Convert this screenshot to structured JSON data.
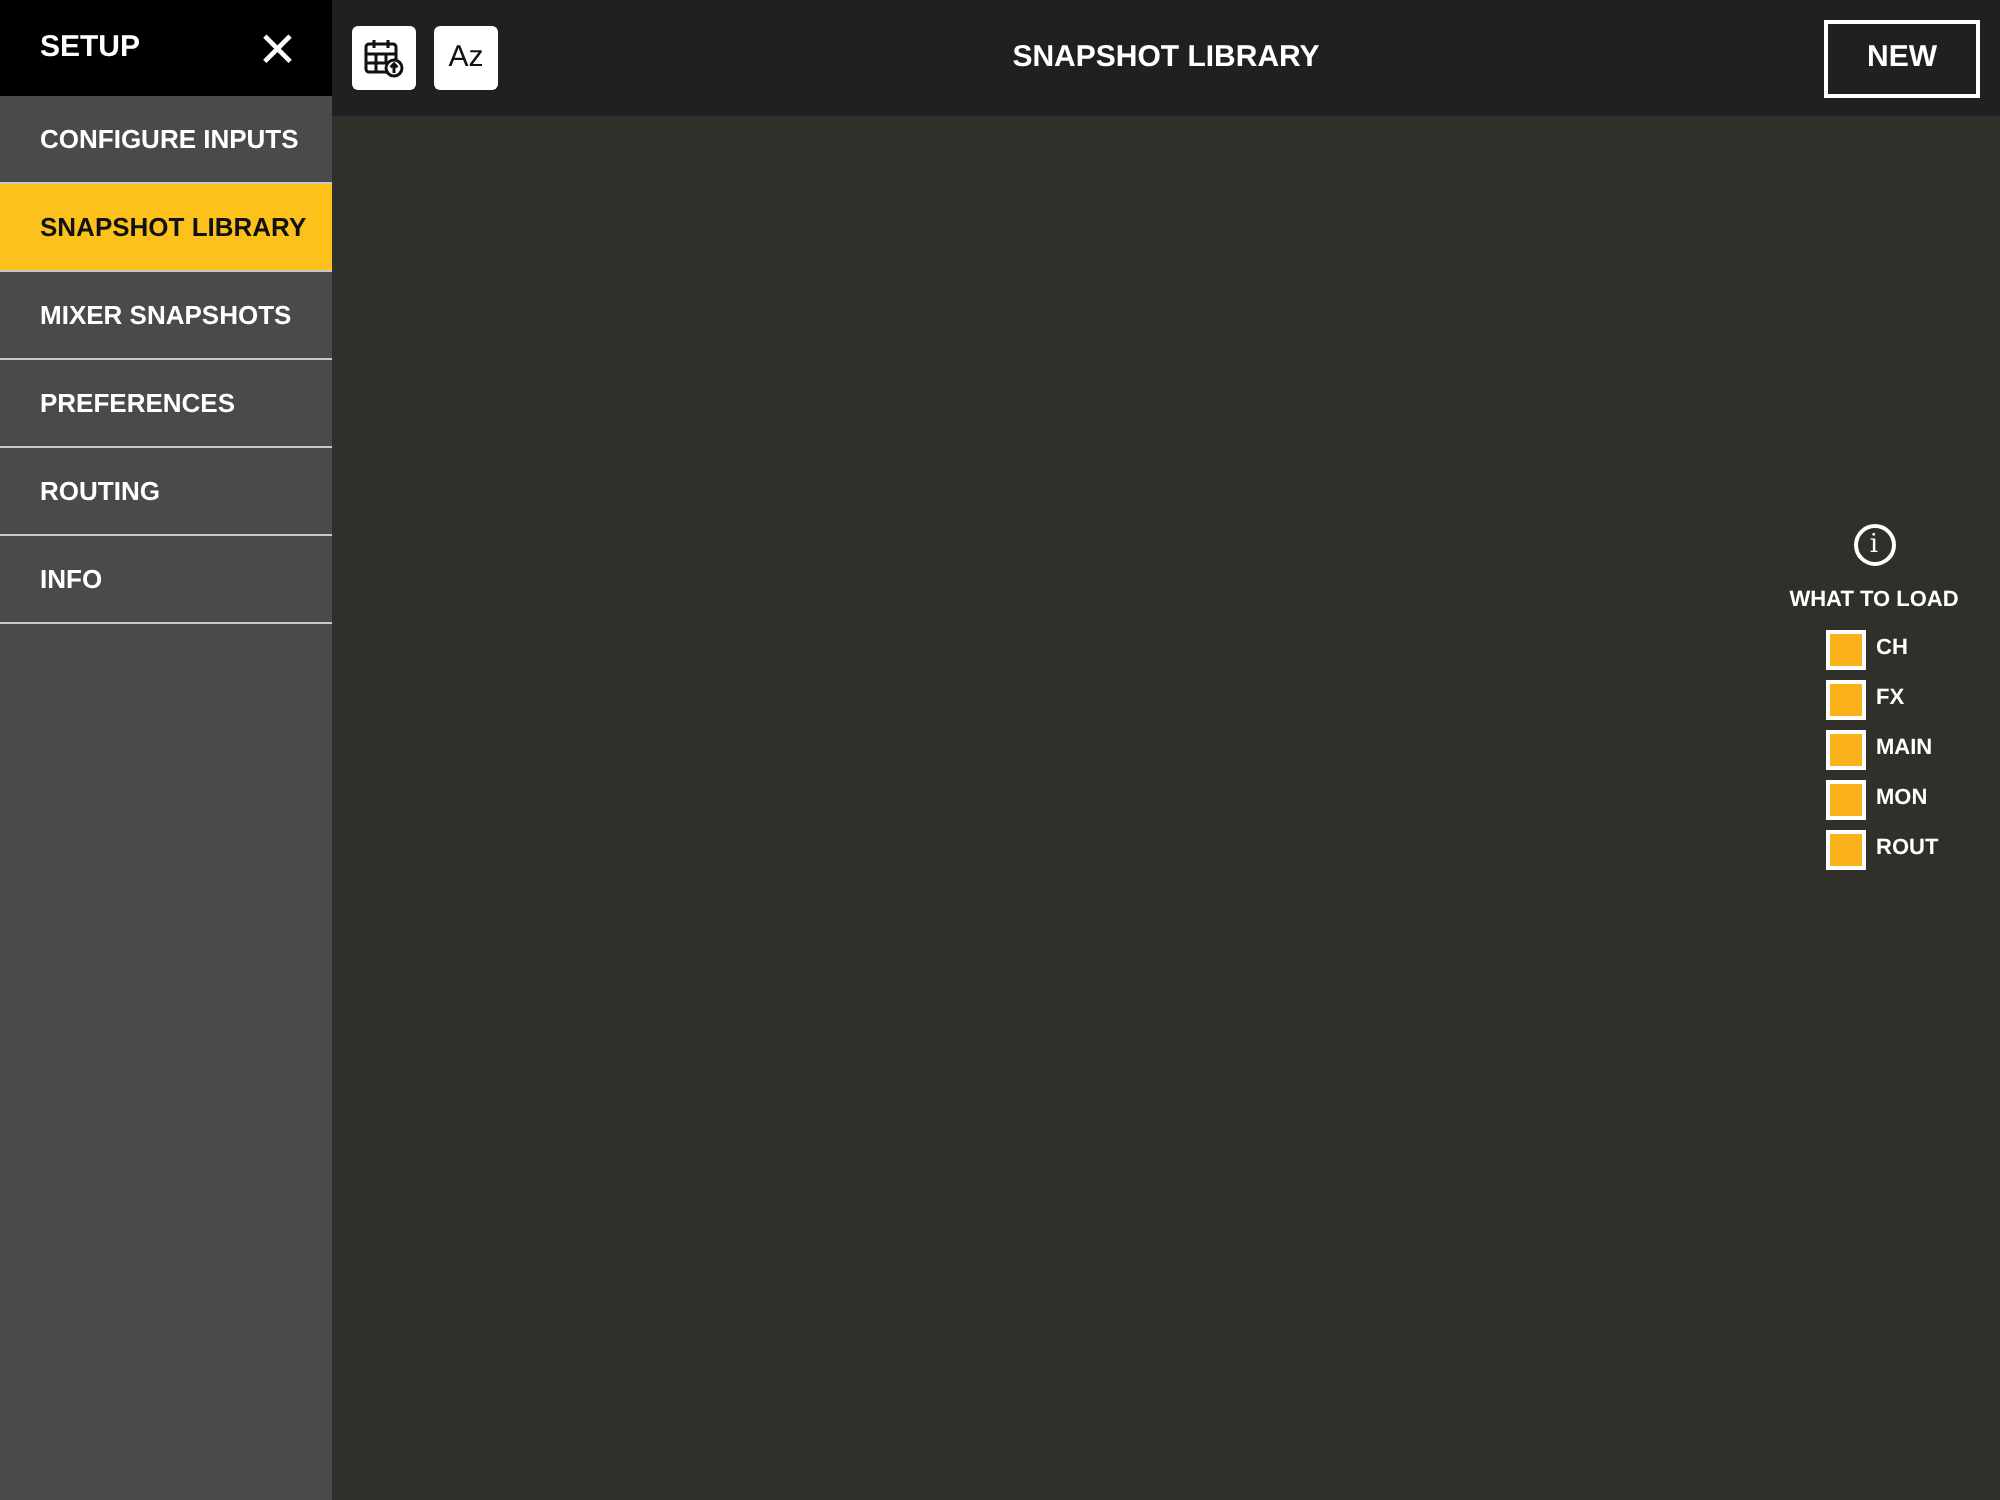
{
  "sidebar": {
    "title": "SETUP",
    "close": "×",
    "items": [
      {
        "label": "CONFIGURE INPUTS",
        "selected": false
      },
      {
        "label": "SNAPSHOT LIBRARY",
        "selected": true
      },
      {
        "label": "MIXER SNAPSHOTS",
        "selected": false
      },
      {
        "label": "PREFERENCES",
        "selected": false
      },
      {
        "label": "ROUTING",
        "selected": false
      },
      {
        "label": "INFO",
        "selected": false
      }
    ]
  },
  "toolbar": {
    "sort_button": "Az",
    "title": "SNAPSHOT LIBRARY",
    "new_button": "NEW"
  },
  "what_to_load": {
    "info": "i",
    "title": "WHAT TO LOAD",
    "options": [
      {
        "label": "CH",
        "checked": true
      },
      {
        "label": "FX",
        "checked": true
      },
      {
        "label": "MAIN",
        "checked": true
      },
      {
        "label": "MON",
        "checked": true
      },
      {
        "label": "ROUT",
        "checked": true
      }
    ]
  }
}
